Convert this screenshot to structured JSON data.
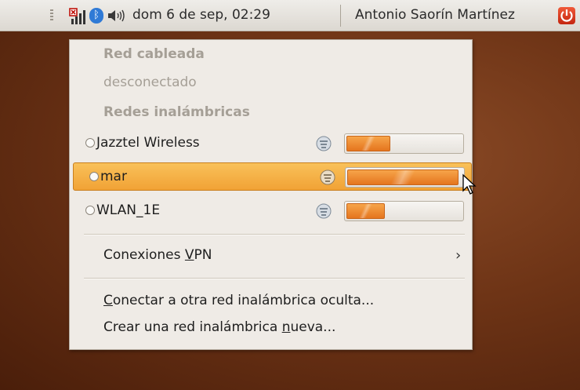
{
  "panel": {
    "clock": "dom  6 de sep, 02:29",
    "user": "Antonio Saorín Martínez",
    "icons": [
      "network-icon",
      "bluetooth-icon",
      "volume-icon",
      "power-icon"
    ]
  },
  "menu": {
    "wired_header": "Red cableada",
    "wired_status": "desconectado",
    "wireless_header": "Redes inalámbricas",
    "networks": [
      {
        "name": "Jazztel Wireless",
        "signal": 0.4,
        "secured": true,
        "highlighted": false
      },
      {
        "name": "mar",
        "signal": 0.97,
        "secured": true,
        "highlighted": true
      },
      {
        "name": "WLAN_1E",
        "signal": 0.35,
        "secured": true,
        "highlighted": false
      }
    ],
    "vpn": {
      "label_pre": "Conexiones ",
      "label_u": "V",
      "label_post": "PN",
      "arrow": "›"
    },
    "hidden": {
      "label_u": "C",
      "label_post": "onectar a otra red inalámbrica oculta..."
    },
    "new": {
      "label_pre": "Crear una red inalámbrica ",
      "label_u": "n",
      "label_post": "ueva..."
    }
  },
  "colors": {
    "highlight": "#f1a235",
    "signal_fill": "#e5751e",
    "menu_bg": "#efebe6",
    "disabled_text": "#a59f96"
  }
}
